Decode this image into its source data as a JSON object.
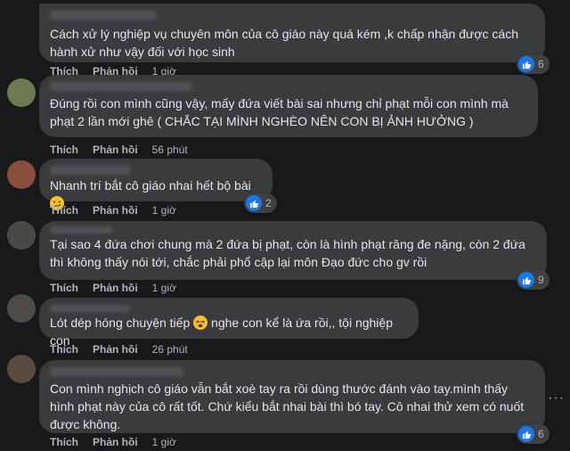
{
  "comments": [
    {
      "text": "Cách xử lý nghiệp vụ chuyên môn của cô giáo này quá kém ,k chấp nhận được cách hành xử như vậy đối với học sinh",
      "like": "Thích",
      "reply": "Phản hồi",
      "time": "1 giờ",
      "reactions": "6"
    },
    {
      "text": "Đúng rồi con mình cũng vậy, mấy đứa viết bài sai nhưng chỉ phạt mỗi con mình mà phạt 2 lần mới ghê ( CHẮC TẠI MÌNH NGHÈO NÊN CON BỊ ẢNH HƯỞNG )",
      "like": "Thích",
      "reply": "Phản hồi",
      "time": "56 phút"
    },
    {
      "text": "Nhanh trí bắt cô giáo nhai hết bộ bài",
      "like": "Thích",
      "reply": "Phản hồi",
      "time": "1 giờ",
      "reactions": "2"
    },
    {
      "text": "Tại sao 4 đứa chơi chung mà 2 đứa bị phạt, còn là hình phạt răng đe nặng, còn 2 đứa thì không thấy nói tới, chắc phải phổ cập lại môn Đạo đức cho gv rồi",
      "like": "Thích",
      "reply": "Phản hồi",
      "time": "1 giờ",
      "reactions": "9"
    },
    {
      "text_before": "Lót dép hóng chuyện tiếp",
      "text_after": "nghe con kể là ứa rồi,, tội nghiệp con",
      "like": "Thích",
      "reply": "Phản hồi",
      "time": "26 phút"
    },
    {
      "text": "Con mình nghịch cô giáo vẫn bắt xoè tay ra rồi dùng thước đánh vào tay.mình thấy hình phạt này của cô rất tốt. Chứ kiểu bắt nhai bài thì bó tay. Cô nhai thử xem có nuốt được không.",
      "like": "Thích",
      "reply": "Phản hồi",
      "time": "1 giờ",
      "reactions": "6"
    }
  ],
  "icons": {
    "like": "like-icon",
    "smirk": "smirk-emoji-icon",
    "tired": "tired-emoji-icon",
    "more": "more-options-icon"
  },
  "colors": {
    "background": "#18191a",
    "bubble": "#3a3b3c",
    "text": "#e4e6eb",
    "muted": "#b0b3b8",
    "like_blue": "#1877f2"
  }
}
